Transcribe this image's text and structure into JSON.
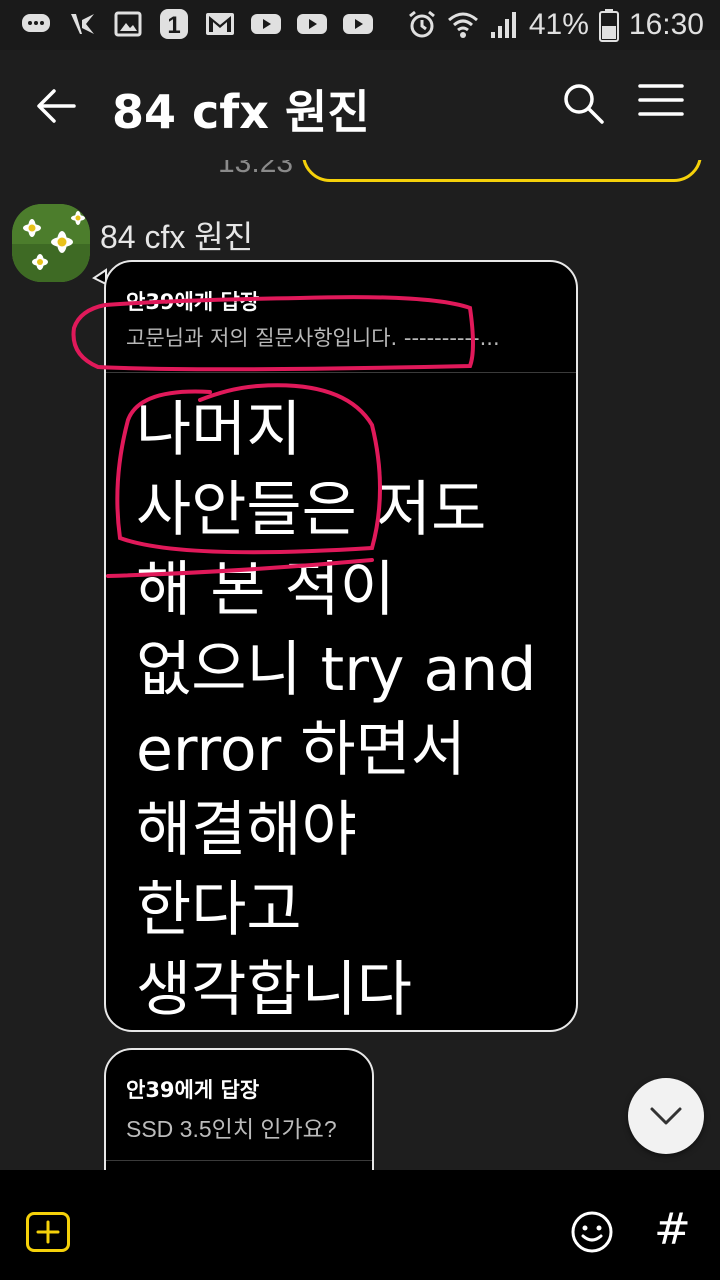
{
  "status_bar": {
    "battery": "41%",
    "time": "16:30",
    "icons": [
      "chat-bubble-icon",
      "vpn-icon",
      "gallery-icon",
      "notification-1-icon",
      "gmail-icon",
      "youtube-icon",
      "youtube-icon",
      "youtube-icon",
      "alarm-icon",
      "wifi-icon",
      "signal-icon",
      "battery-icon"
    ]
  },
  "header": {
    "title": "84 cfx 원진",
    "back_icon": "arrow-left-icon",
    "search_icon": "search-icon",
    "menu_icon": "menu-icon"
  },
  "chat": {
    "previous_time": "13:23",
    "sender_name": "84 cfx 원진",
    "messages": [
      {
        "reply_to": "안39에게 답장",
        "reply_preview": "고문님과 저의 질문사항입니다. ----------...",
        "text_lines": [
          "나머지",
          "사안들은 저도",
          "해 본 적이",
          "없으니 try and",
          "error 하면서",
          "해결해야",
          "한다고",
          "생각합니다"
        ]
      },
      {
        "reply_to": "안39에게 답장",
        "reply_preview": "SSD 3.5인치 인가요?"
      }
    ]
  },
  "colors": {
    "accent_yellow": "#f5d10a",
    "annotation_pink": "#e0195a",
    "bubble_bg": "#000000",
    "background": "#1e1e1e"
  },
  "bottom_bar": {
    "plus_icon": "plus-icon",
    "emoji_icon": "emoji-icon",
    "hash_label": "#"
  }
}
